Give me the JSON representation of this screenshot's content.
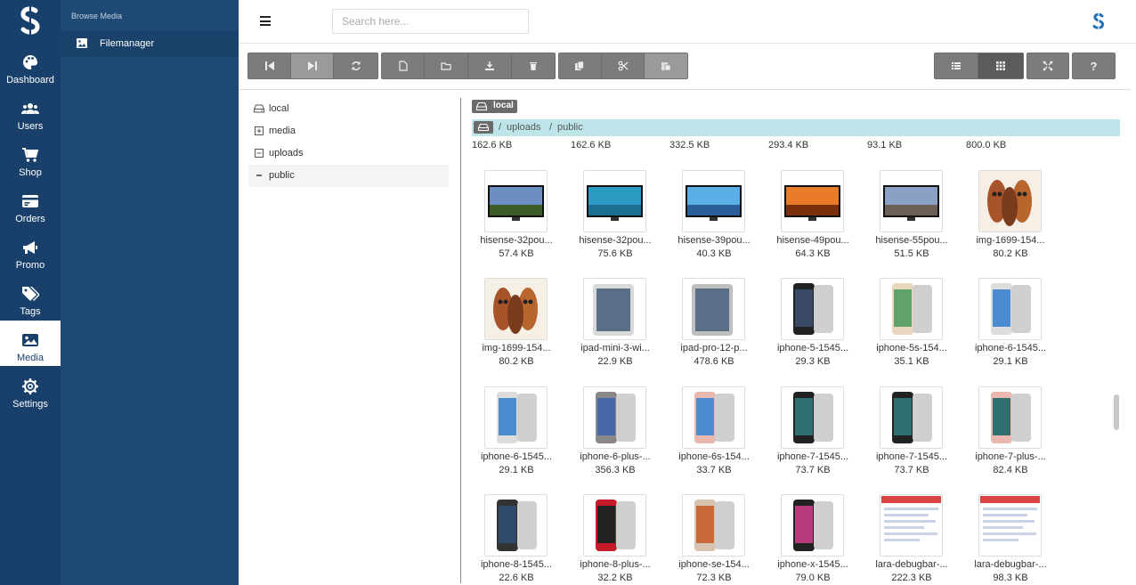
{
  "nav": {
    "items": [
      {
        "label": "Dashboard",
        "icon": "palette-icon"
      },
      {
        "label": "Users",
        "icon": "users-icon"
      },
      {
        "label": "Shop",
        "icon": "cart-icon"
      },
      {
        "label": "Orders",
        "icon": "orders-icon"
      },
      {
        "label": "Promo",
        "icon": "megaphone-icon"
      },
      {
        "label": "Tags",
        "icon": "tags-icon"
      },
      {
        "label": "Media",
        "icon": "image-icon",
        "active": true
      },
      {
        "label": "Settings",
        "icon": "gear-icon"
      }
    ]
  },
  "sidebar": {
    "heading": "Browse Media",
    "item": {
      "label": "Filemanager",
      "icon": "image-icon"
    }
  },
  "header": {
    "search_placeholder": "Search here..."
  },
  "tree": {
    "items": [
      {
        "label": "local",
        "icon": "hdd-icon"
      },
      {
        "label": "media",
        "icon": "plus-square-icon"
      },
      {
        "label": "uploads",
        "icon": "minus-square-icon"
      },
      {
        "label": "public",
        "icon": "dash-icon",
        "selected": true
      }
    ]
  },
  "disk": {
    "label": "local"
  },
  "breadcrumb": [
    "uploads",
    "/",
    "public"
  ],
  "top_sizes": [
    "162.6 KB",
    "162.6 KB",
    "332.5 KB",
    "293.4 KB",
    "93.1 KB",
    "800.0 KB"
  ],
  "files": [
    [
      {
        "name": "hisense-32pou...",
        "size": "57.4 KB"
      },
      {
        "name": "hisense-32pou...",
        "size": "75.6 KB"
      },
      {
        "name": "hisense-39pou...",
        "size": "40.3 KB"
      },
      {
        "name": "hisense-49pou...",
        "size": "64.3 KB"
      },
      {
        "name": "hisense-55pou...",
        "size": "51.5 KB"
      },
      {
        "name": "img-1699-154...",
        "size": "80.2 KB"
      }
    ],
    [
      {
        "name": "img-1699-154...",
        "size": "80.2 KB"
      },
      {
        "name": "ipad-mini-3-wi...",
        "size": "22.9 KB"
      },
      {
        "name": "ipad-pro-12-p...",
        "size": "478.6 KB"
      },
      {
        "name": "iphone-5-1545...",
        "size": "29.3 KB"
      },
      {
        "name": "iphone-5s-154...",
        "size": "35.1 KB"
      },
      {
        "name": "iphone-6-1545...",
        "size": "29.1 KB"
      }
    ],
    [
      {
        "name": "iphone-6-1545...",
        "size": "29.1 KB"
      },
      {
        "name": "iphone-6-plus-...",
        "size": "356.3 KB"
      },
      {
        "name": "iphone-6s-154...",
        "size": "33.7 KB"
      },
      {
        "name": "iphone-7-1545...",
        "size": "73.7 KB"
      },
      {
        "name": "iphone-7-1545...",
        "size": "73.7 KB"
      },
      {
        "name": "iphone-7-plus-...",
        "size": "82.4 KB"
      }
    ],
    [
      {
        "name": "iphone-8-1545...",
        "size": "22.6 KB"
      },
      {
        "name": "iphone-8-plus-...",
        "size": "32.2 KB"
      },
      {
        "name": "iphone-se-154...",
        "size": "72.3 KB"
      },
      {
        "name": "iphone-x-1545...",
        "size": "79.0 KB"
      },
      {
        "name": "lara-debugbar-...",
        "size": "222.3 KB"
      },
      {
        "name": "lara-debugbar-...",
        "size": "98.3 KB"
      }
    ]
  ],
  "colors": {
    "rail": "#18406a",
    "sidebar": "#1f4a75",
    "crumb_bg": "#bee6ea",
    "toolbar": "#7c7c7c"
  }
}
